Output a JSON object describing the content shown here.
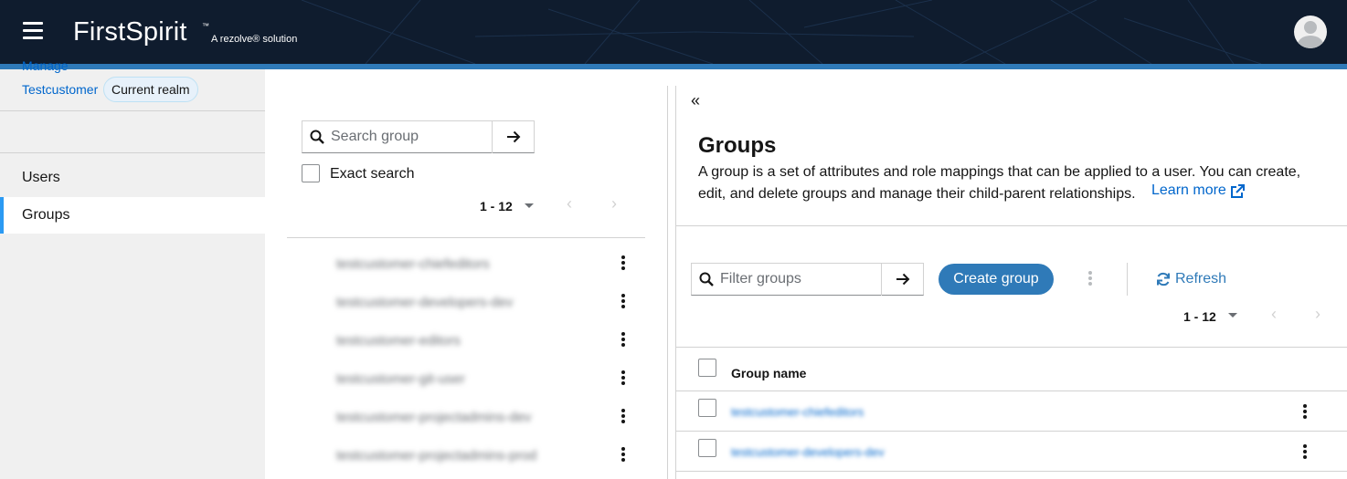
{
  "header": {
    "brand": "FirstSpirit",
    "brand_tm": "™",
    "brand_sub": "A rezolve® solution",
    "menu_icon": "hamburger-menu-icon",
    "avatar_icon": "user-avatar-icon"
  },
  "sidebar": {
    "realm_name": "Testcustomer",
    "realm_badge": "Current realm",
    "section_label": "Manage",
    "items": [
      {
        "label": "Users",
        "active": false
      },
      {
        "label": "Groups",
        "active": true
      }
    ]
  },
  "tree": {
    "search_placeholder": "Search group",
    "exact_search_label": "Exact search",
    "pager_count": "1 - 12",
    "items": [
      "testcustomer-chiefeditors",
      "testcustomer-developers-dev",
      "testcustomer-editors",
      "testcustomer-git-user",
      "testcustomer-projectadmins-dev",
      "testcustomer-projectadmins-prod"
    ]
  },
  "main": {
    "title": "Groups",
    "description": "A group is a set of attributes and role mappings that can be applied to a user. You can create, edit, and delete groups and manage their child-parent relationships.",
    "learn_more": "Learn more",
    "filter_placeholder": "Filter groups",
    "create_button": "Create group",
    "refresh_button": "Refresh",
    "pager_count": "1 - 12",
    "table": {
      "column_header": "Group name",
      "rows": [
        "testcustomer-chiefeditors",
        "testcustomer-developers-dev"
      ]
    }
  },
  "colors": {
    "header_bg": "#0f1c2e",
    "accent": "#2f7ab8",
    "link": "#0066cc"
  }
}
